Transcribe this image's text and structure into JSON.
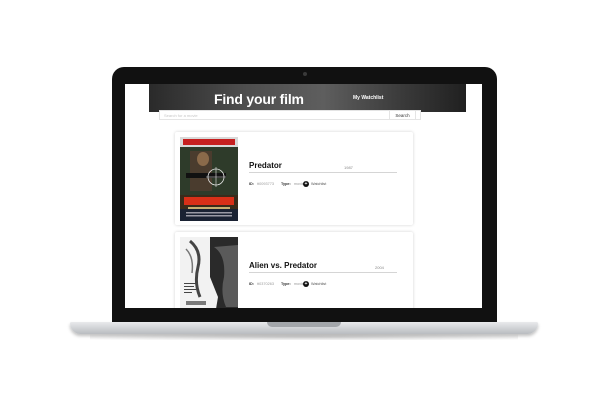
{
  "header": {
    "title": "Find your film",
    "watchlist_link": "My Watchlist"
  },
  "search": {
    "placeholder": "Search for a movie",
    "button_label": "Search"
  },
  "results": [
    {
      "title": "Predator",
      "year": "1987",
      "id_label": "ID:",
      "id_value": "tt0093773",
      "type_label": "Type:",
      "type_value": "movie",
      "watchlist_label": "Watchlist"
    },
    {
      "title": "Alien vs. Predator",
      "year": "2004",
      "id_label": "ID:",
      "id_value": "tt0370263",
      "type_label": "Type:",
      "type_value": "movie",
      "watchlist_label": "Watchlist"
    }
  ],
  "icons": {
    "watchlist_add": "plus-circle-icon"
  },
  "colors": {
    "header_bg": "#3d3d3d",
    "card_bg": "#ffffff",
    "title_text": "#111111"
  }
}
